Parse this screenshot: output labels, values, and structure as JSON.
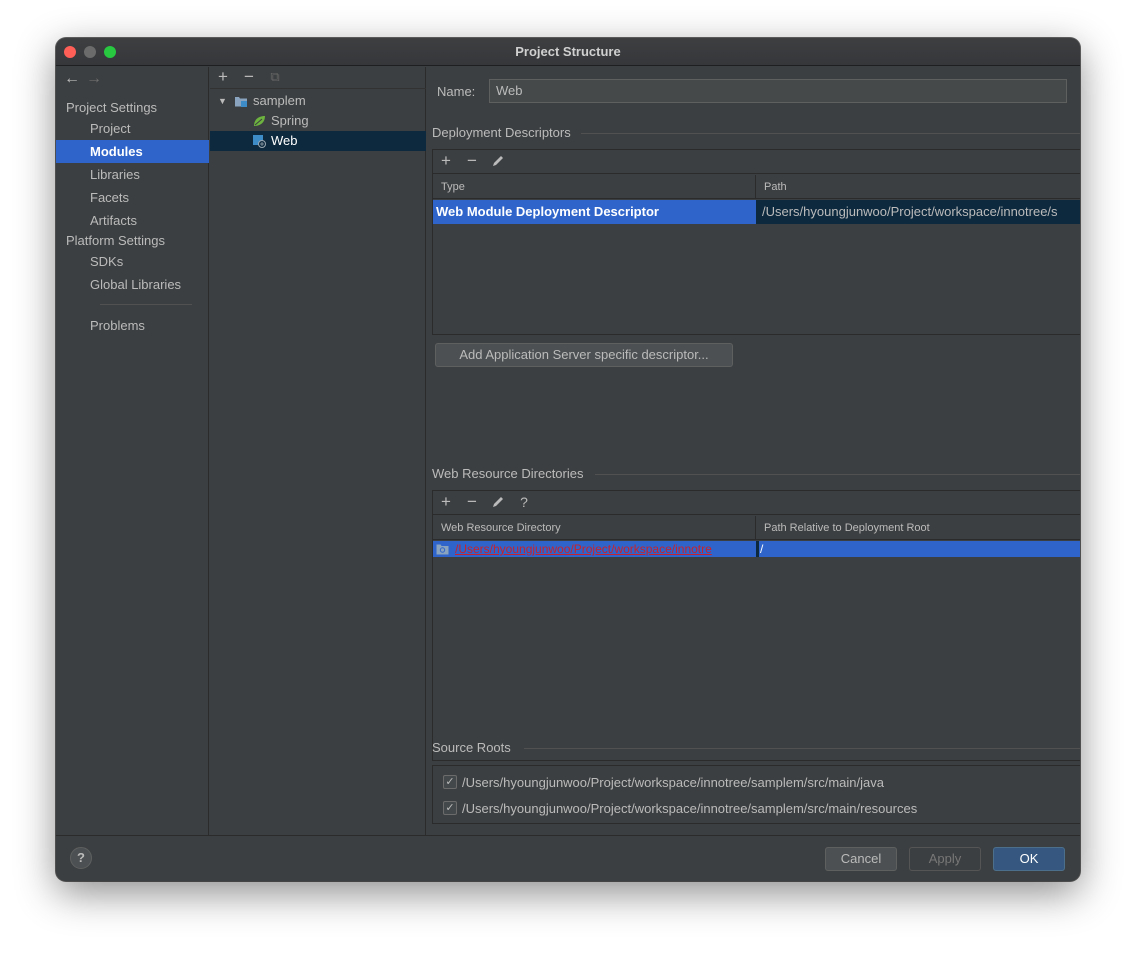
{
  "window": {
    "title": "Project Structure"
  },
  "sidebar": {
    "project_settings_heading": "Project Settings",
    "platform_settings_heading": "Platform Settings",
    "items": [
      {
        "label": "Project"
      },
      {
        "label": "Modules"
      },
      {
        "label": "Libraries"
      },
      {
        "label": "Facets"
      },
      {
        "label": "Artifacts"
      },
      {
        "label": "SDKs"
      },
      {
        "label": "Global Libraries"
      },
      {
        "label": "Problems"
      }
    ],
    "selected": "Modules"
  },
  "tree": {
    "nodes": [
      {
        "label": "samplem",
        "icon": "module-folder-icon"
      },
      {
        "label": "Spring",
        "icon": "spring-leaf-icon"
      },
      {
        "label": "Web",
        "icon": "web-facet-icon"
      }
    ],
    "selected": "Web"
  },
  "main": {
    "name_label": "Name:",
    "name_value": "Web",
    "deployment": {
      "title": "Deployment Descriptors",
      "columns": [
        "Type",
        "Path"
      ],
      "rows": [
        {
          "type": "Web Module Deployment Descriptor",
          "path": "/Users/hyoungjunwoo/Project/workspace/innotree/s"
        }
      ],
      "add_button": "Add Application Server specific descriptor..."
    },
    "web_resources": {
      "title": "Web Resource Directories",
      "columns": [
        "Web Resource Directory",
        "Path Relative to Deployment Root"
      ],
      "rows": [
        {
          "directory": "/Users/hyoungjunwoo/Project/workspace/innotre",
          "relative": "/"
        }
      ],
      "help_glyph": "?"
    },
    "source_roots": {
      "title": "Source Roots",
      "items": [
        {
          "path": "/Users/hyoungjunwoo/Project/workspace/innotree/samplem/src/main/java",
          "checked": true
        },
        {
          "path": "/Users/hyoungjunwoo/Project/workspace/innotree/samplem/src/main/resources",
          "checked": true
        }
      ]
    }
  },
  "footer": {
    "help": "?",
    "cancel": "Cancel",
    "apply": "Apply",
    "ok": "OK"
  },
  "colors": {
    "background": "#3c3f41",
    "selection": "#2f65ca",
    "tree_selection": "#0d293e",
    "error_red": "#c7222d",
    "ok_button": "#365880"
  }
}
